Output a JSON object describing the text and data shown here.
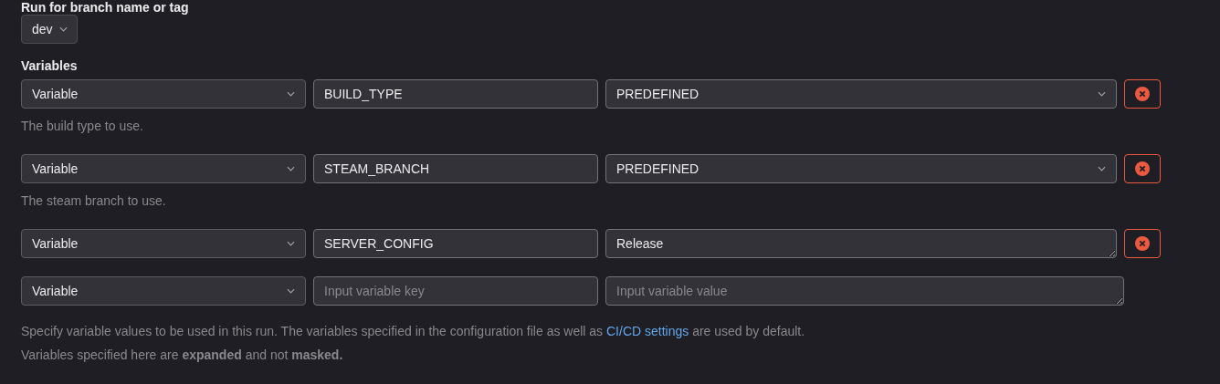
{
  "branch": {
    "label": "Run for branch name or tag",
    "value": "dev"
  },
  "variables": {
    "label": "Variables",
    "rows": [
      {
        "type": "Variable",
        "key": "BUILD_TYPE",
        "kind": "dropdown",
        "value": "PREDEFINED",
        "removable": true,
        "help": "The build type to use."
      },
      {
        "type": "Variable",
        "key": "STEAM_BRANCH",
        "kind": "dropdown",
        "value": "PREDEFINED",
        "removable": true,
        "help": "The steam branch to use."
      },
      {
        "type": "Variable",
        "key": "SERVER_CONFIG",
        "kind": "text",
        "value": "Release",
        "removable": true
      },
      {
        "type": "Variable",
        "key_placeholder": "Input variable key",
        "kind": "text",
        "value_placeholder": "Input variable value",
        "removable": false
      }
    ]
  },
  "footer": {
    "before": "Specify variable values to be used in this run. The variables specified in the configuration file as well as ",
    "link": "CI/CD settings",
    "after": " are used by default.",
    "note": "Variables specified here are **expanded** and not **masked.**"
  }
}
